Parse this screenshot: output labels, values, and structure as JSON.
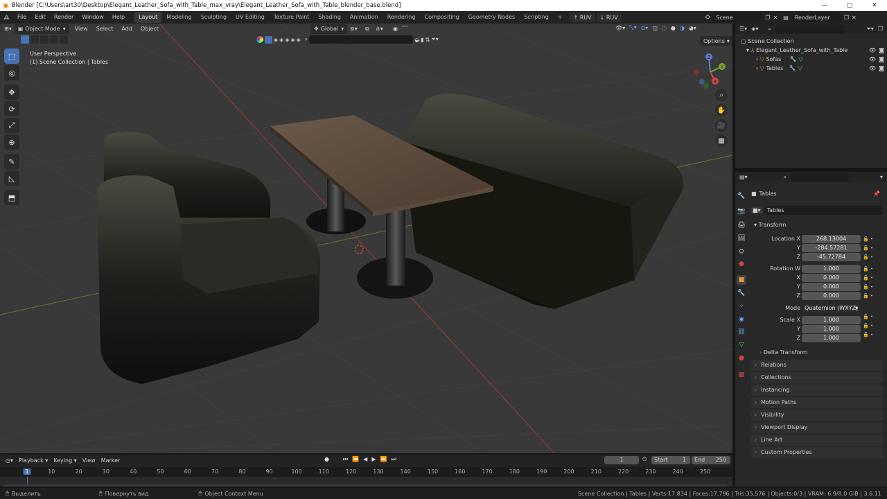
{
  "window": {
    "title": "Blender [C:\\Users\\art30\\Desktop\\Elegant_Leather_Sofa_with_Table_max_vray\\Elegant_Leather_Sofa_with_Table_blender_base.blend]",
    "min": "—",
    "max": "▢",
    "close": "✕"
  },
  "menu": {
    "items": [
      "File",
      "Edit",
      "Render",
      "Window",
      "Help"
    ],
    "workspaces": [
      "Layout",
      "Modeling",
      "Sculpting",
      "UV Editing",
      "Texture Paint",
      "Shading",
      "Animation",
      "Rendering",
      "Compositing",
      "Geometry Nodes",
      "Scripting"
    ],
    "add_ws": "+",
    "ruv_up": "↑ RUV",
    "ruv_down": "↓ RUV",
    "scene_label": "Scene",
    "renderlayer_label": "RenderLayer"
  },
  "viewport": {
    "mode": "Object Mode",
    "menus": [
      "View",
      "Select",
      "Add",
      "Object"
    ],
    "orientation": "Global",
    "options": "Options",
    "info_line1": "User Perspective",
    "info_line2": "(1) Scene Collection | Tables",
    "gizmo": {
      "z": "Z",
      "y": "Y",
      "x": "X"
    }
  },
  "outliner": {
    "root": "Scene Collection",
    "items": [
      {
        "label": "Elegant_Leather_Sofa_with_Table",
        "depth": 1
      },
      {
        "label": "Sofas",
        "depth": 2
      },
      {
        "label": "Tables",
        "depth": 2
      }
    ]
  },
  "properties": {
    "object_name": "Tables",
    "object_name_field": "Tables",
    "transform_label": "Transform",
    "location_label": "Location X",
    "location": [
      "268.13004",
      "-284.57281",
      "-45.72784"
    ],
    "rotation_label": "Rotation W",
    "rotation": [
      "1.000",
      "0.000",
      "0.000",
      "0.000"
    ],
    "axis_y": "Y",
    "axis_z": "Z",
    "axis_x": "X",
    "mode_label": "Mode",
    "mode_value": "Quaternion (WXYZ)",
    "scale_label": "Scale X",
    "scale": [
      "1.000",
      "1.000",
      "1.000"
    ],
    "delta_transform": "Delta Transform",
    "panels": [
      "Relations",
      "Collections",
      "Instancing",
      "Motion Paths",
      "Visibility",
      "Viewport Display",
      "Line Art",
      "Custom Properties"
    ]
  },
  "timeline": {
    "menus": [
      "Playback",
      "Keying",
      "View",
      "Marker"
    ],
    "current_frame": "1",
    "start_label": "Start",
    "start": "1",
    "end_label": "End",
    "end": "250",
    "ticks": [
      "1",
      "10",
      "20",
      "30",
      "40",
      "50",
      "60",
      "70",
      "80",
      "90",
      "100",
      "110",
      "120",
      "130",
      "140",
      "150",
      "160",
      "170",
      "180",
      "190",
      "200",
      "210",
      "220",
      "230",
      "240",
      "250"
    ]
  },
  "status": {
    "select": "Выделить",
    "rotate": "Повернуть вид",
    "context": "Object Context Menu",
    "stats": "Scene Collection | Tables | Verts:17,834 | Faces:17,796 | Tris:35,576 | Objects:0/3 | VRAM: 6.9/8.0 GiB | 3.6.11"
  },
  "colors": {
    "accent": "#4772b3",
    "bg": "#393939",
    "panel": "#282828"
  }
}
